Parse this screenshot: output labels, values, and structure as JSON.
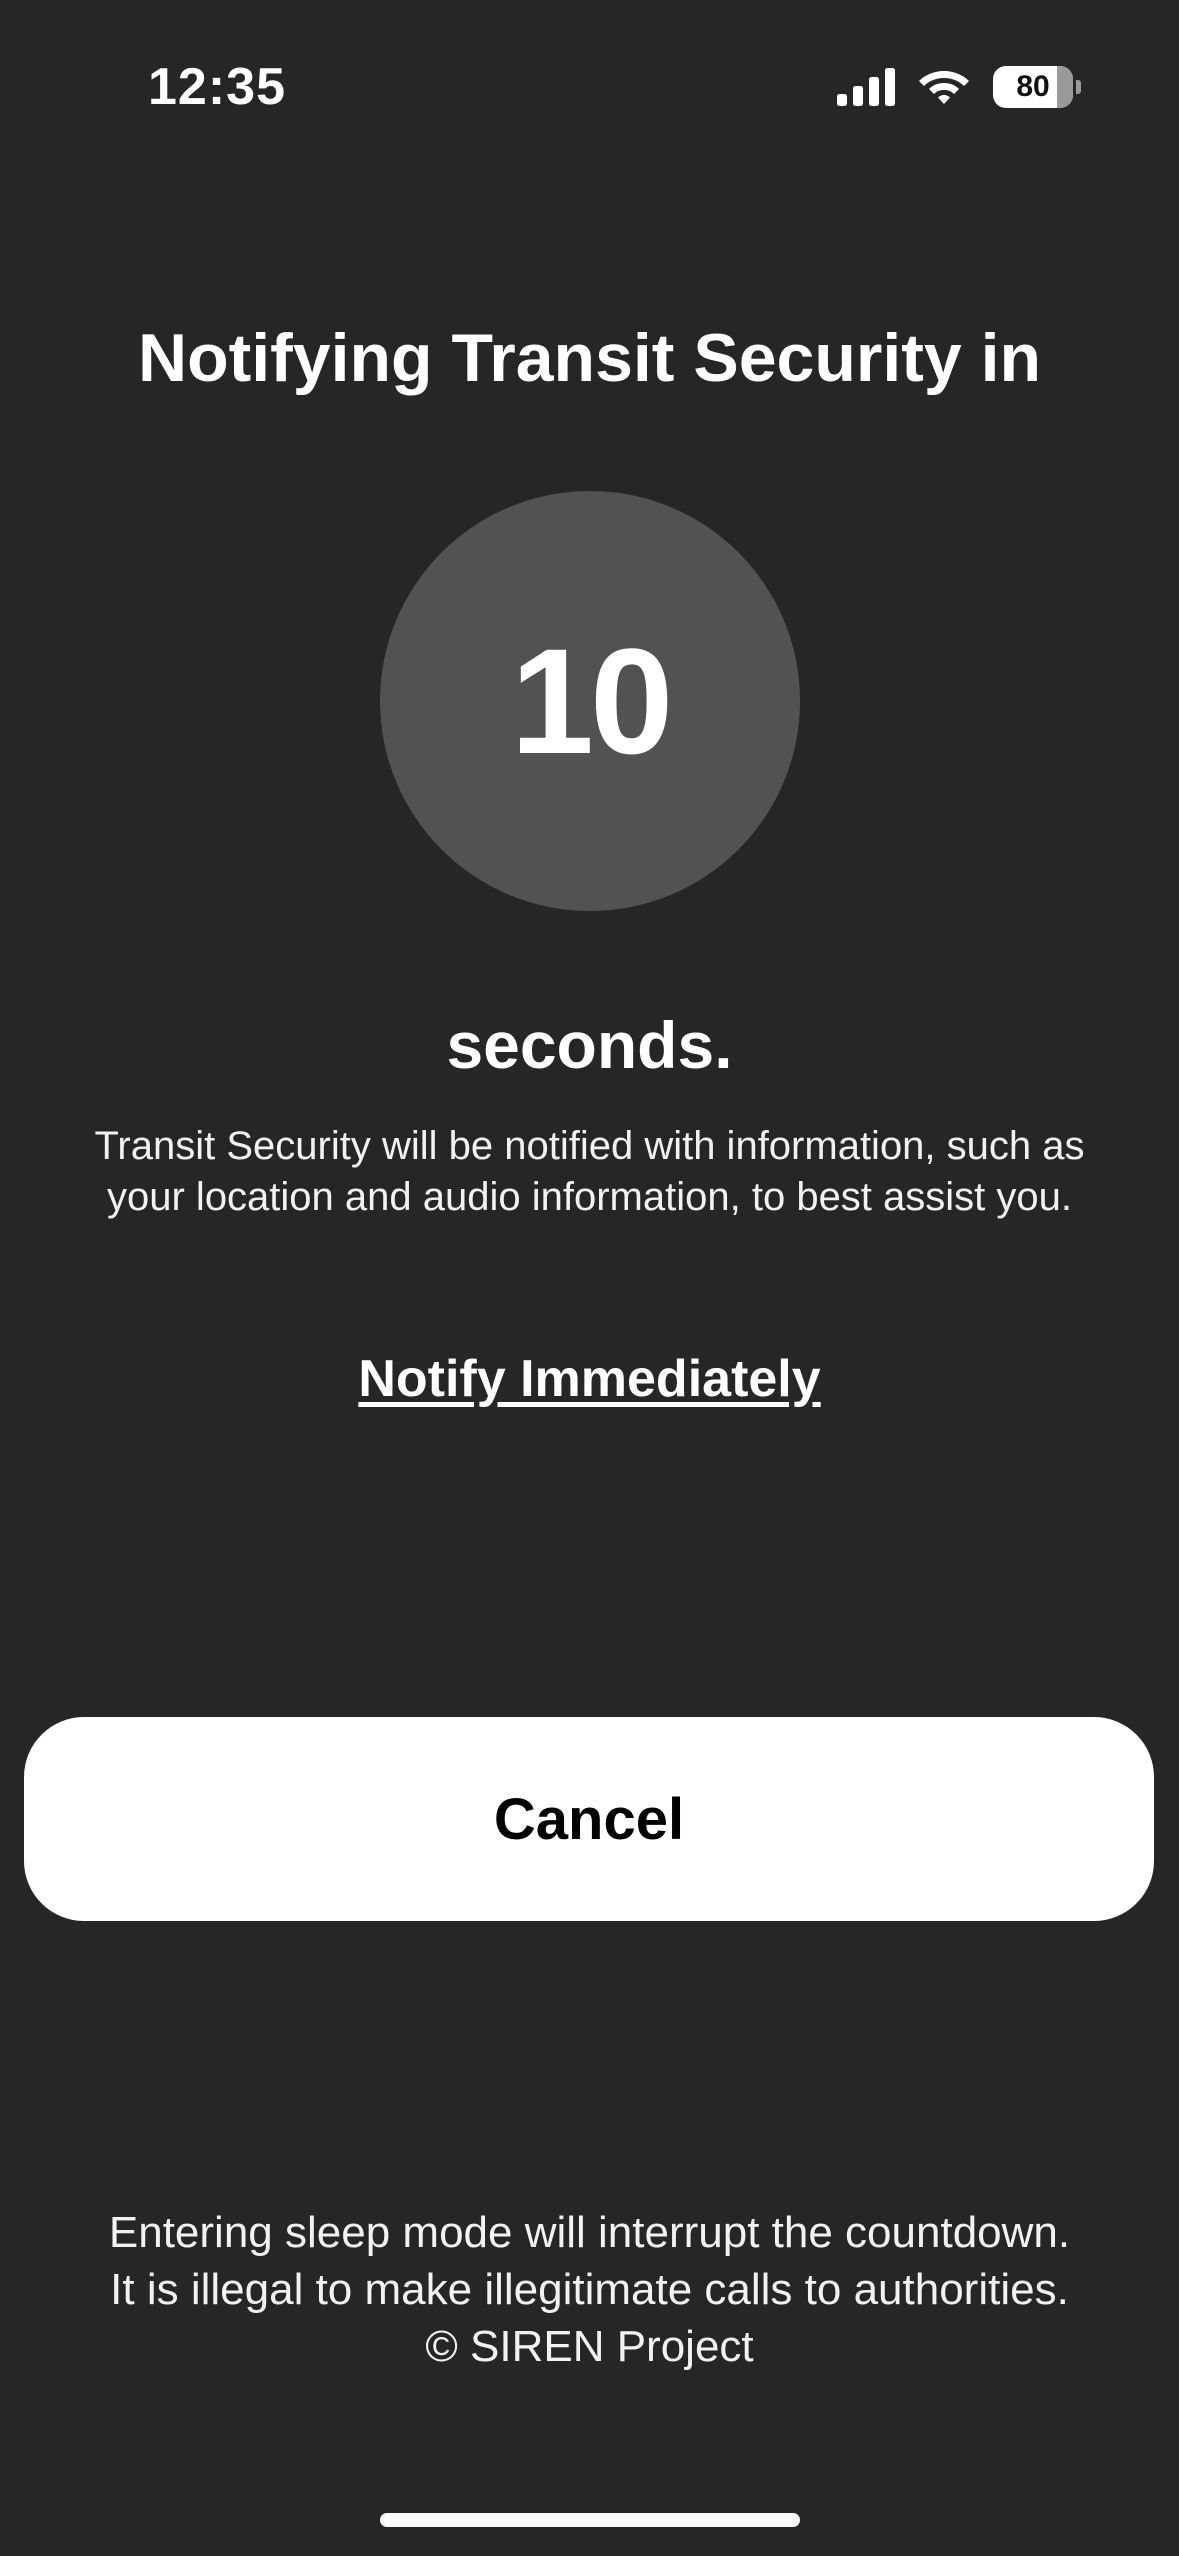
{
  "status_bar": {
    "time": "12:35",
    "battery_level": "80",
    "battery_fraction": 0.8,
    "icons": [
      "signal-icon",
      "wifi-icon",
      "battery-icon"
    ]
  },
  "screen": {
    "title": "Notifying Transit Security in",
    "countdown": "10",
    "seconds_label": "seconds.",
    "description": "Transit Security will be notified with information, such as your location and audio information, to best assist you.",
    "notify_link": "Notify Immediately",
    "cancel_label": "Cancel"
  },
  "footer": {
    "lines": [
      "Entering sleep mode will interrupt the countdown.",
      "It is illegal to make illegitimate calls to authorities.",
      "© SIREN Project"
    ]
  },
  "colors": {
    "background": "#262626",
    "circle": "#525252",
    "button": "#ffffff",
    "text": "#ffffff"
  }
}
